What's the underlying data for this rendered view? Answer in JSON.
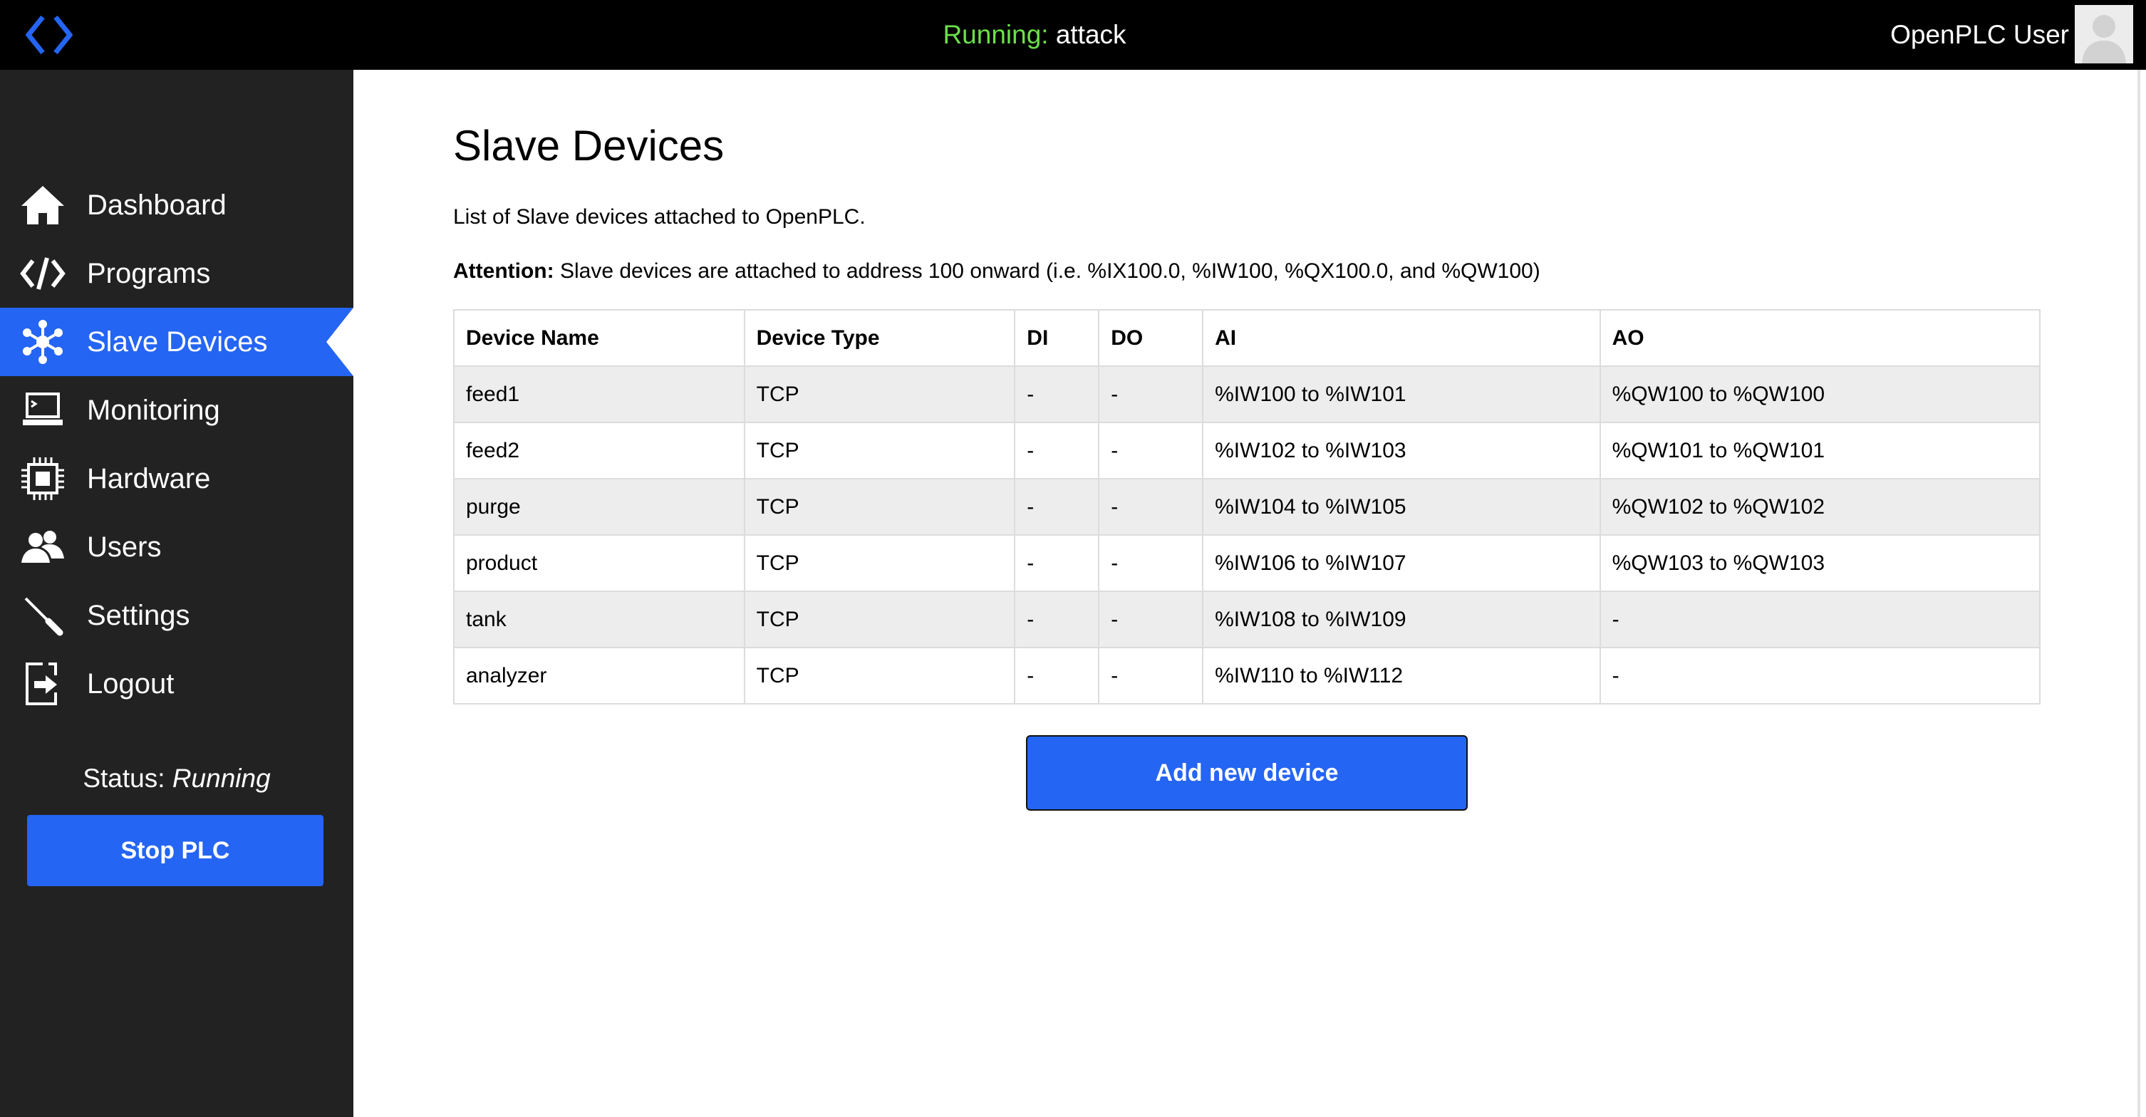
{
  "topbar": {
    "logo_icon": "code-brackets-icon",
    "running_label": "Running:",
    "program_name": "attack",
    "user_name": "OpenPLC User",
    "avatar_icon": "user-avatar-icon"
  },
  "sidebar": {
    "items": [
      {
        "label": "Dashboard",
        "icon": "home-icon"
      },
      {
        "label": "Programs",
        "icon": "code-icon"
      },
      {
        "label": "Slave Devices",
        "icon": "network-icon",
        "active": true
      },
      {
        "label": "Monitoring",
        "icon": "monitor-icon"
      },
      {
        "label": "Hardware",
        "icon": "chip-icon"
      },
      {
        "label": "Users",
        "icon": "users-icon"
      },
      {
        "label": "Settings",
        "icon": "wrench-icon"
      },
      {
        "label": "Logout",
        "icon": "logout-icon"
      }
    ],
    "status_label": "Status:",
    "status_value": "Running",
    "stop_button": "Stop PLC"
  },
  "main": {
    "title": "Slave Devices",
    "subtitle": "List of Slave devices attached to OpenPLC.",
    "attention_label": "Attention:",
    "attention_text": " Slave devices are attached to address 100 onward (i.e. %IX100.0, %IW100, %QX100.0, and %QW100)",
    "table": {
      "headers": [
        "Device Name",
        "Device Type",
        "DI",
        "DO",
        "AI",
        "AO"
      ],
      "rows": [
        [
          "feed1",
          "TCP",
          "-",
          "-",
          "%IW100 to %IW101",
          "%QW100 to %QW100"
        ],
        [
          "feed2",
          "TCP",
          "-",
          "-",
          "%IW102 to %IW103",
          "%QW101 to %QW101"
        ],
        [
          "purge",
          "TCP",
          "-",
          "-",
          "%IW104 to %IW105",
          "%QW102 to %QW102"
        ],
        [
          "product",
          "TCP",
          "-",
          "-",
          "%IW106 to %IW107",
          "%QW103 to %QW103"
        ],
        [
          "tank",
          "TCP",
          "-",
          "-",
          "%IW108 to %IW109",
          "-"
        ],
        [
          "analyzer",
          "TCP",
          "-",
          "-",
          "%IW110 to %IW112",
          "-"
        ]
      ]
    },
    "add_button": "Add new device"
  },
  "colors": {
    "accent": "#2565F3",
    "running": "#6BE04A",
    "sidebar_bg": "#222222",
    "topbar_bg": "#000000"
  }
}
